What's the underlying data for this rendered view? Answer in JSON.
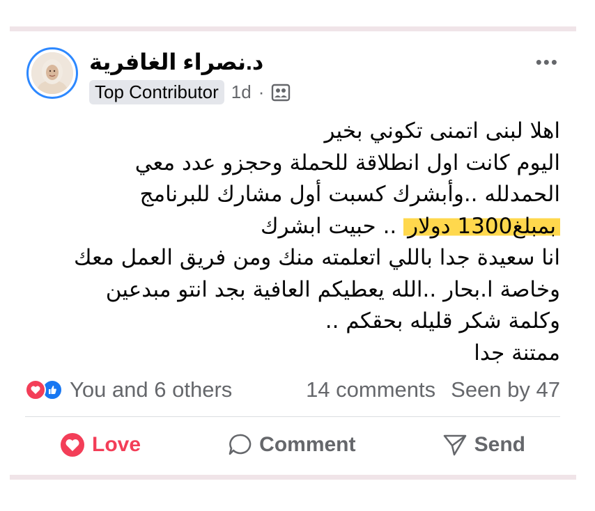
{
  "post": {
    "author": "د.نصراء الغافرية",
    "badge": "Top Contributor",
    "time": "1d",
    "separator": "·",
    "privacy_icon": "friends-icon",
    "more_label": "•••",
    "lines": [
      "اهلا لبنى اتمنى تكوني بخير",
      "اليوم كانت اول انطلاقة للحملة وحجزو عدد معي",
      "الحمدلله ..وأبشرك كسبت أول مشارك للبرنامج",
      "انا سعيدة جدا باللي اتعلمته منك ومن فريق العمل معك",
      "وخاصة ا.بحار ..الله يعطيكم العافية بجد انتو مبدعين",
      "وكلمة شكر قليله بحقكم ..",
      "ممتنة جدا"
    ],
    "highlight_line": {
      "highlighted": "بمبلغ1300 دولار",
      "rest": " .. حبيت ابشرك"
    }
  },
  "stats": {
    "reactions_text": "You and 6 others",
    "comments": "14 comments",
    "seen": "Seen by 47"
  },
  "actions": {
    "love": "Love",
    "comment": "Comment",
    "send": "Send"
  },
  "colors": {
    "love": "#f33e58",
    "like": "#1877f2",
    "highlight": "#ffd84d",
    "avatar_ring": "#2d88ff"
  }
}
